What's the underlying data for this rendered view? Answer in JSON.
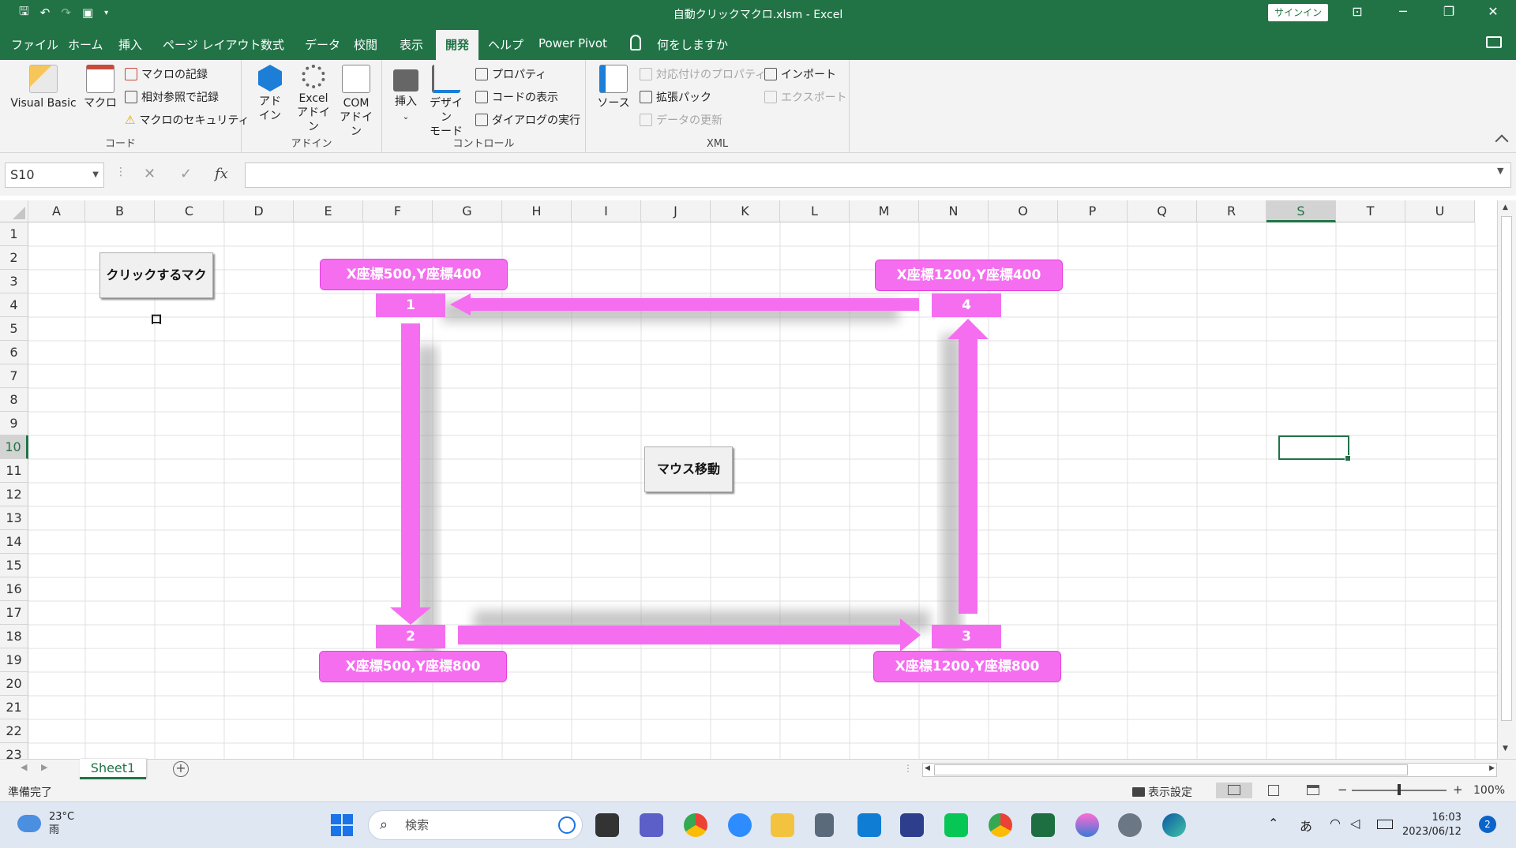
{
  "window": {
    "title": "自動クリックマクロ.xlsm  -  Excel",
    "signin": "サインイン"
  },
  "menu": {
    "tabs": [
      "ファイル",
      "ホーム",
      "挿入",
      "ページ レイアウト",
      "数式",
      "データ",
      "校閲",
      "表示",
      "開発",
      "ヘルプ",
      "Power Pivot"
    ],
    "active": "開発",
    "tell_me": "何をしますか"
  },
  "ribbon": {
    "code": {
      "label": "コード",
      "visual_basic": "Visual Basic",
      "macro": "マクロ",
      "record": "マクロの記録",
      "relative": "相対参照で記録",
      "security": "マクロのセキュリティ"
    },
    "addins": {
      "label": "アドイン",
      "addin_line1": "アド",
      "addin_line2": "イン",
      "excel_line1": "Excel",
      "excel_line2": "アドイン",
      "com_line1": "COM",
      "com_line2": "アドイン"
    },
    "controls": {
      "label": "コントロール",
      "insert": "挿入",
      "insert_arrow": "⌄",
      "design_line1": "デザイン",
      "design_line2": "モード",
      "properties": "プロパティ",
      "view_code": "コードの表示",
      "run_dialog": "ダイアログの実行"
    },
    "xml": {
      "label": "XML",
      "source": "ソース",
      "map_properties": "対応付けのプロパティ",
      "expansion_packs": "拡張パック",
      "refresh_data": "データの更新",
      "import": "インポート",
      "export": "エクスポート"
    }
  },
  "formula_bar": {
    "name_box": "S10",
    "cancel": "✕",
    "enter": "✓",
    "fx": "fx",
    "value": ""
  },
  "grid": {
    "columns": [
      "A",
      "B",
      "C",
      "D",
      "E",
      "F",
      "G",
      "H",
      "I",
      "J",
      "K",
      "L",
      "M",
      "N",
      "O",
      "P",
      "Q",
      "R",
      "S",
      "T",
      "U"
    ],
    "rows": [
      "1",
      "2",
      "3",
      "4",
      "5",
      "6",
      "7",
      "8",
      "9",
      "10",
      "11",
      "12",
      "13",
      "14",
      "15",
      "16",
      "17",
      "18",
      "19",
      "20",
      "21",
      "22",
      "23"
    ],
    "selected_column": "S",
    "selected_row": "10"
  },
  "shapes": {
    "click_macro_button": "クリックするマクロ",
    "move_mouse_button": "マウス移動",
    "label_1": "X座標500,Y座標400",
    "label_2": "X座標500,Y座標800",
    "label_3": "X座標1200,Y座標800",
    "label_4": "X座標1200,Y座標400",
    "num_1": "1",
    "num_2": "2",
    "num_3": "3",
    "num_4": "4",
    "accent_color": "#f56ef0"
  },
  "sheets": {
    "tabs": [
      "Sheet1"
    ],
    "add": "+"
  },
  "status": {
    "ready": "準備完了",
    "display_settings": "表示設定",
    "zoom": "100%",
    "zoom_minus": "−",
    "zoom_plus": "+"
  },
  "taskbar": {
    "temperature": "23°C",
    "weather": "雨",
    "search": "検索",
    "ime": "あ",
    "time": "16:03",
    "date": "2023/06/12",
    "notifications": "2"
  },
  "colors": {
    "excel_green": "#217346",
    "ribbon_bg": "#f3f3f3"
  }
}
